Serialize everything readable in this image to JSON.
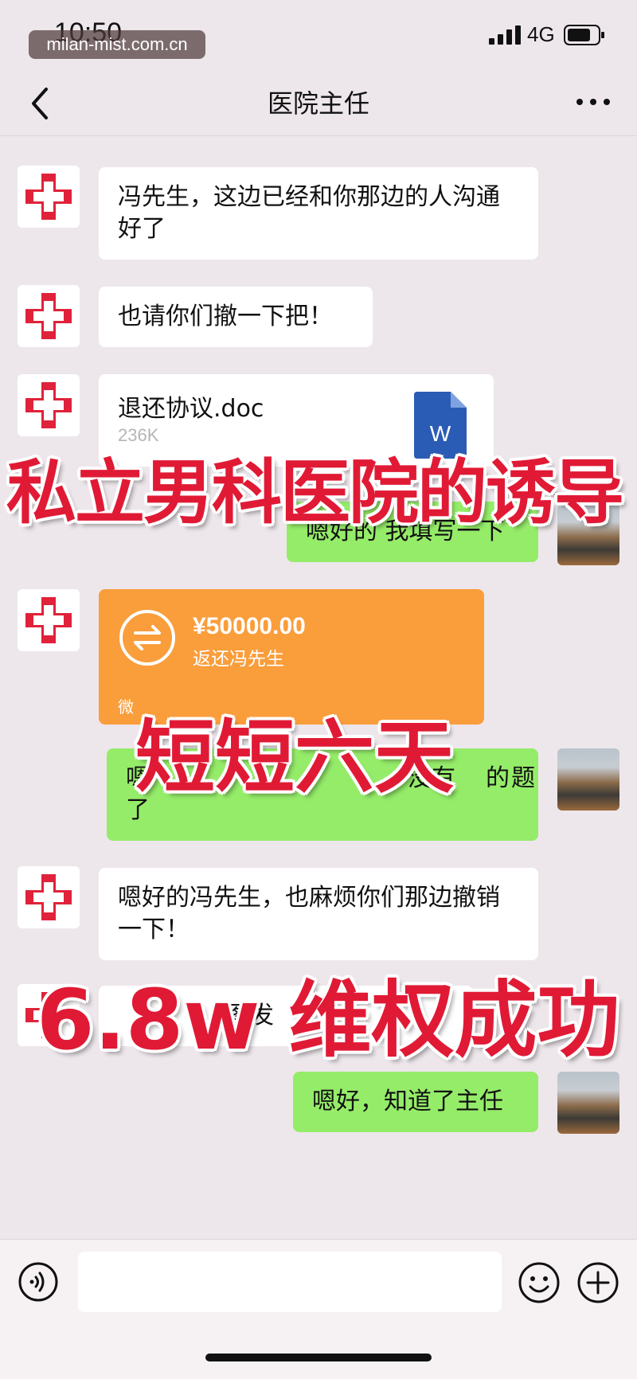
{
  "status_bar": {
    "time": "10:50",
    "network": "4G"
  },
  "watermark": "milan-mist.com.cn",
  "header": {
    "title": "医院主任"
  },
  "messages": [
    {
      "sender": "hospital",
      "text": "冯先生，这边已经和你那边的人沟通好了"
    },
    {
      "sender": "hospital",
      "text": "也请你们撤一下把！"
    },
    {
      "sender": "hospital",
      "type": "file",
      "file_name": "退还协议.doc",
      "file_size": "236K"
    },
    {
      "sender": "user",
      "text": "嗯好的 我填写一下"
    },
    {
      "sender": "hospital",
      "type": "transfer",
      "amount": "¥50000.00",
      "note": "返还冯先生",
      "footer": "微"
    },
    {
      "sender": "user",
      "text_visible_start": "嗯",
      "text_visible_mid": "没有",
      "text_visible_end2": "的",
      "text_visible_end": "题",
      "text_line2": "了"
    },
    {
      "sender": "hospital",
      "text": "嗯好的冯先生，也麻烦你们那边撤销一下！"
    },
    {
      "sender": "hospital",
      "text_visible": "图发"
    },
    {
      "sender": "user",
      "text": "嗯好，知道了主任"
    }
  ],
  "overlay": {
    "line1": "私立男科医院的诱导",
    "line2": "短短六天",
    "line3": "6.8w 维权成功"
  },
  "colors": {
    "overlay_red": "#e01a35",
    "bubble_green": "#95ec69",
    "transfer_orange": "#fa9d3b",
    "hospital_cross": "#e0223a"
  }
}
